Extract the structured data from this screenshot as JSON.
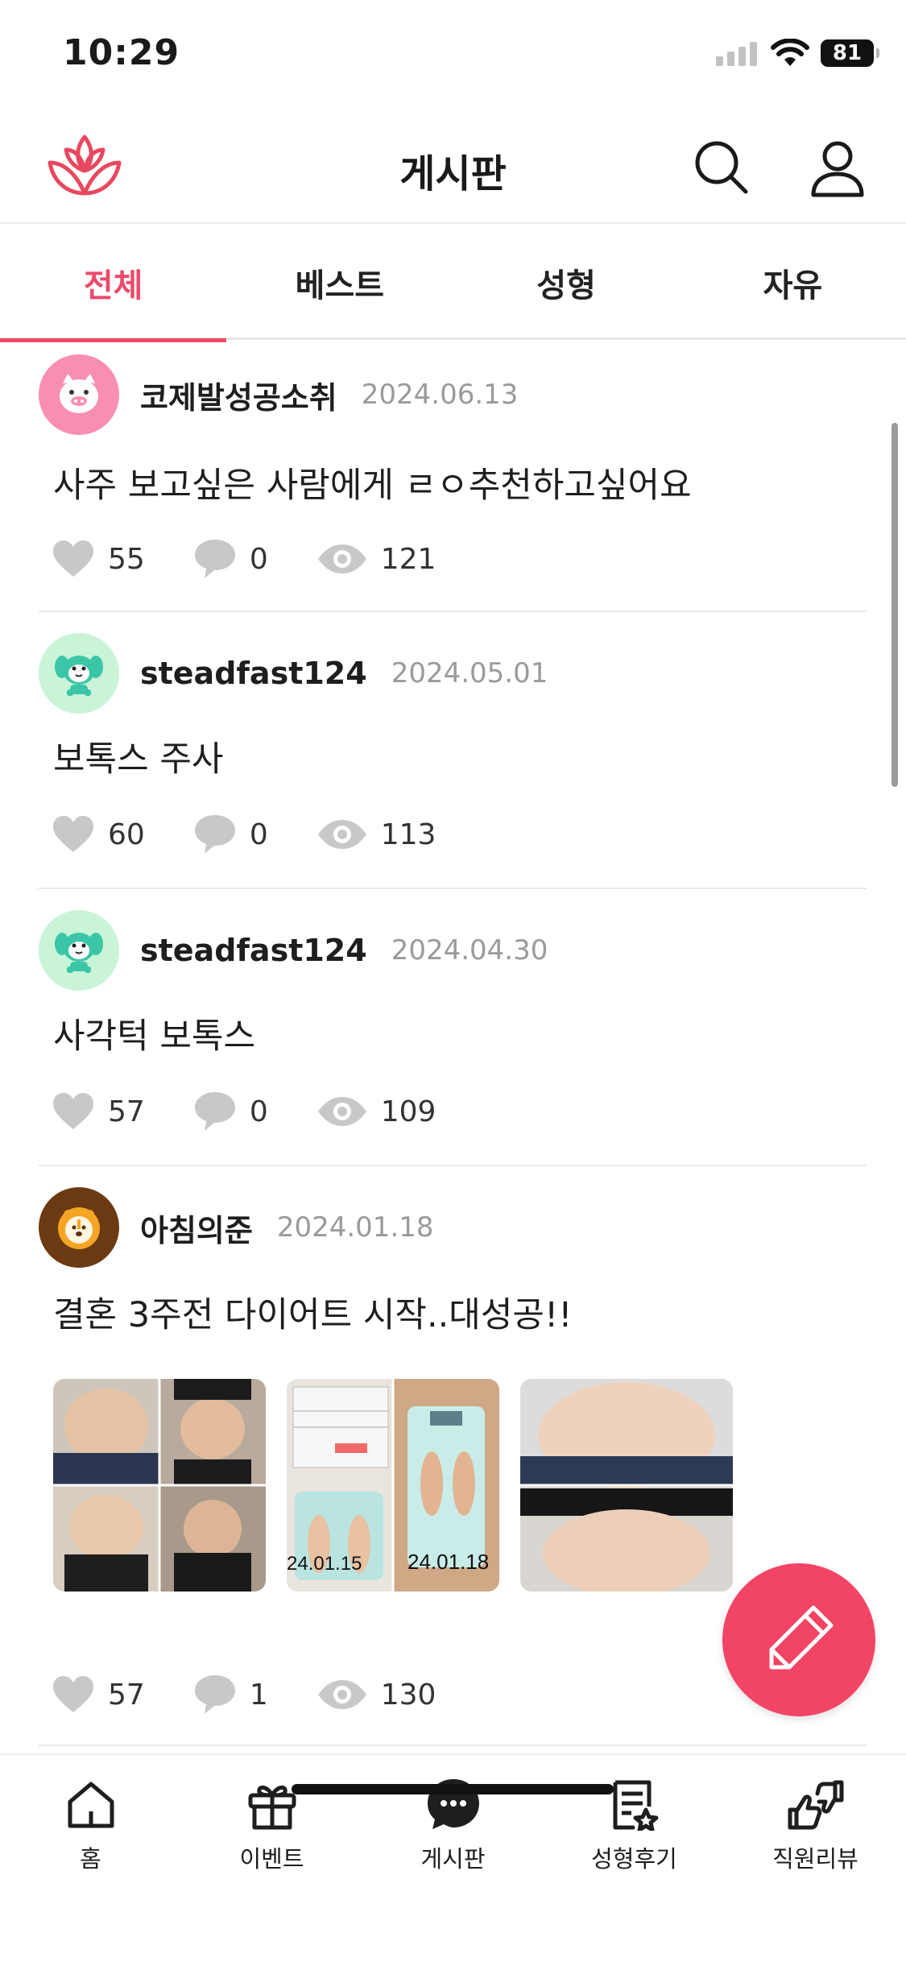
{
  "status_bar": {
    "time": "10:29",
    "battery": "81"
  },
  "header": {
    "title": "게시판"
  },
  "tabs": [
    {
      "label": "전체",
      "active": true
    },
    {
      "label": "베스트",
      "active": false
    },
    {
      "label": "성형",
      "active": false
    },
    {
      "label": "자유",
      "active": false
    }
  ],
  "posts": [
    {
      "author": "코제발성공소취",
      "date": "2024.06.13",
      "title": "사주 보고싶은 사람에게 ㄹㅇ추천하고싶어요",
      "likes": "55",
      "comments": "0",
      "views": "121",
      "avatar": "pig-avatar"
    },
    {
      "author": "steadfast124",
      "date": "2024.05.01",
      "title": "보톡스 주사",
      "likes": "60",
      "comments": "0",
      "views": "113",
      "avatar": "puppy-avatar"
    },
    {
      "author": "steadfast124",
      "date": "2024.04.30",
      "title": "사각턱 보톡스",
      "likes": "57",
      "comments": "0",
      "views": "109",
      "avatar": "puppy-avatar"
    },
    {
      "author": "아침의준",
      "date": "2024.01.18",
      "title": "결혼 3주전 다이어트 시작..대성공!!",
      "likes": "57",
      "comments": "1",
      "views": "130",
      "avatar": "lion-avatar",
      "images": [
        {
          "name": "belly-collage-image"
        },
        {
          "name": "scale-photo-image",
          "captions": [
            "24.01.15",
            "24.01.18"
          ]
        },
        {
          "name": "before-after-image"
        }
      ]
    }
  ],
  "bottom_nav": [
    {
      "label": "홈",
      "icon": "home-icon"
    },
    {
      "label": "이벤트",
      "icon": "gift-icon"
    },
    {
      "label": "게시판",
      "icon": "chat-bubble-icon",
      "active": true
    },
    {
      "label": "성형후기",
      "icon": "review-document-icon"
    },
    {
      "label": "직원리뷰",
      "icon": "thumbs-icon"
    }
  ],
  "colors": {
    "accent": "#ec4a6a",
    "fab": "#f24464",
    "icon_gray": "#c8c8c8"
  }
}
